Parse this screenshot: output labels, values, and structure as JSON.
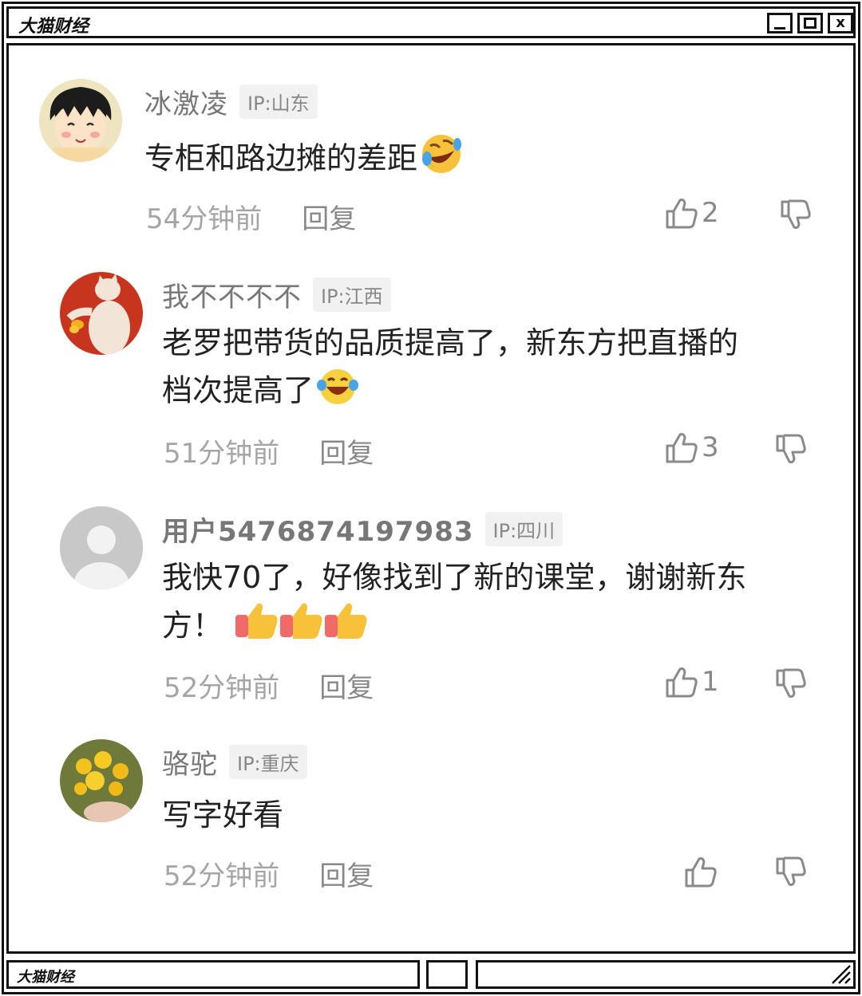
{
  "window": {
    "title": "大猫财经",
    "status_text": "大猫财经"
  },
  "comments": [
    {
      "username": "冰激凌",
      "ip": "IP:山东",
      "text": "专柜和路边摊的差距",
      "emoji": "rofl-emoji",
      "time": "54分钟前",
      "reply": "回复",
      "likes": "2"
    },
    {
      "username": "我不不不不",
      "ip": "IP:江西",
      "text_line1": "老罗把带货的品质提高了，新东方把直播的",
      "text_line2": "档次提高了",
      "emoji": "joy-emoji",
      "time": "51分钟前",
      "reply": "回复",
      "likes": "3"
    },
    {
      "username": "用户5476874197983",
      "ip": "IP:四川",
      "text_line1": "我快70了，好像找到了新的课堂，谢谢新东",
      "text_line2": "方！",
      "emoji": "thumbs-up-emoji",
      "time": "52分钟前",
      "reply": "回复",
      "likes": "1"
    },
    {
      "username": "骆驼",
      "ip": "IP:重庆",
      "text": "写字好看",
      "time": "52分钟前",
      "reply": "回复",
      "likes": ""
    }
  ],
  "colors": {
    "frame": "#111111",
    "username": "#777777",
    "meta": "#9a9a9a",
    "text": "#222222",
    "badge_bg": "#f1f1f1"
  }
}
